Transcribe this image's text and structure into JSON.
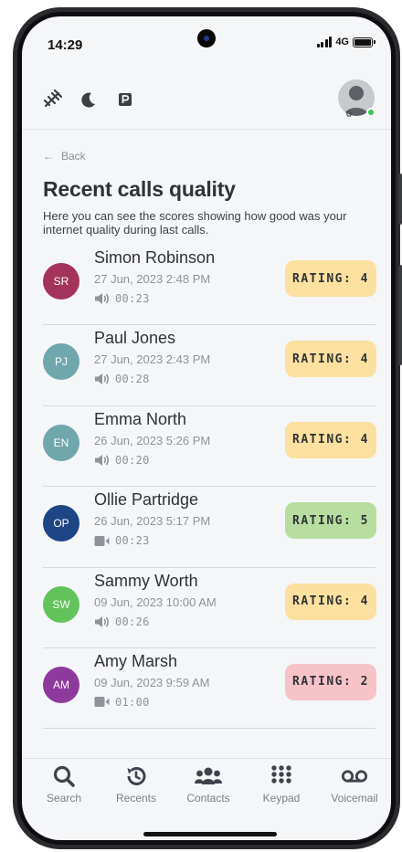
{
  "status_bar": {
    "time": "14:29",
    "network": "4G"
  },
  "header": {
    "icons": [
      "satellite-icon",
      "moon-icon",
      "parking-icon"
    ],
    "avatar": "user-avatar"
  },
  "back_label": "Back",
  "title": "Recent calls quality",
  "description": "Here you can see the scores showing how good was your internet quality during last calls.",
  "calls": [
    {
      "initials": "SR",
      "name": "Simon Robinson",
      "date": "27 Jun, 2023 2:48 PM",
      "type": "audio",
      "duration": "00:23",
      "rating": "RATING: 4",
      "avatar_color": "#a3335a",
      "rating_color": "#fbe0a0"
    },
    {
      "initials": "PJ",
      "name": "Paul Jones",
      "date": "27 Jun, 2023 2:43 PM",
      "type": "audio",
      "duration": "00:28",
      "rating": "RATING: 4",
      "avatar_color": "#6fa7ac",
      "rating_color": "#fbe0a0"
    },
    {
      "initials": "EN",
      "name": "Emma North",
      "date": "26 Jun, 2023 5:26 PM",
      "type": "audio",
      "duration": "00:20",
      "rating": "RATING: 4",
      "avatar_color": "#6fa7ac",
      "rating_color": "#fbe0a0"
    },
    {
      "initials": "OP",
      "name": "Ollie Partridge",
      "date": "26 Jun, 2023 5:17 PM",
      "type": "video",
      "duration": "00:23",
      "rating": "RATING: 5",
      "avatar_color": "#1e4585",
      "rating_color": "#b7dea0"
    },
    {
      "initials": "SW",
      "name": "Sammy Worth",
      "date": "09 Jun, 2023 10:00 AM",
      "type": "audio",
      "duration": "00:26",
      "rating": "RATING: 4",
      "avatar_color": "#62c35d",
      "rating_color": "#fbe0a0"
    },
    {
      "initials": "AM",
      "name": "Amy Marsh",
      "date": "09 Jun, 2023 9:59 AM",
      "type": "video",
      "duration": "01:00",
      "rating": "RATING: 2",
      "avatar_color": "#8e3a9c",
      "rating_color": "#f5c3c8"
    }
  ],
  "nav": [
    {
      "label": "Search",
      "icon": "search-icon"
    },
    {
      "label": "Recents",
      "icon": "recents-icon"
    },
    {
      "label": "Contacts",
      "icon": "contacts-icon"
    },
    {
      "label": "Keypad",
      "icon": "keypad-icon"
    },
    {
      "label": "Voicemail",
      "icon": "voicemail-icon"
    }
  ]
}
